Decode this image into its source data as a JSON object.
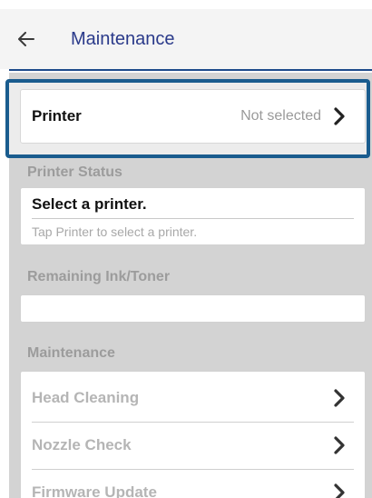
{
  "header": {
    "back_icon": "arrow-left-icon",
    "title": "Maintenance"
  },
  "printer_row": {
    "label": "Printer",
    "value": "Not selected",
    "icon": "chevron-right-icon"
  },
  "printer_status": {
    "section_title": "Printer Status",
    "heading": "Select a printer.",
    "subtext": "Tap Printer to select a printer."
  },
  "remaining_ink": {
    "section_title": "Remaining Ink/Toner"
  },
  "maintenance": {
    "section_title": "Maintenance",
    "items": [
      {
        "label": "Head Cleaning",
        "icon": "chevron-right-icon"
      },
      {
        "label": "Nozzle Check",
        "icon": "chevron-right-icon"
      },
      {
        "label": "Firmware Update",
        "icon": "chevron-right-icon"
      }
    ]
  },
  "colors": {
    "title": "#2a3a8a",
    "highlight_border": "#1a5c8e",
    "content_bg": "#d3d3d3",
    "disabled_text": "#b5b5b5"
  }
}
